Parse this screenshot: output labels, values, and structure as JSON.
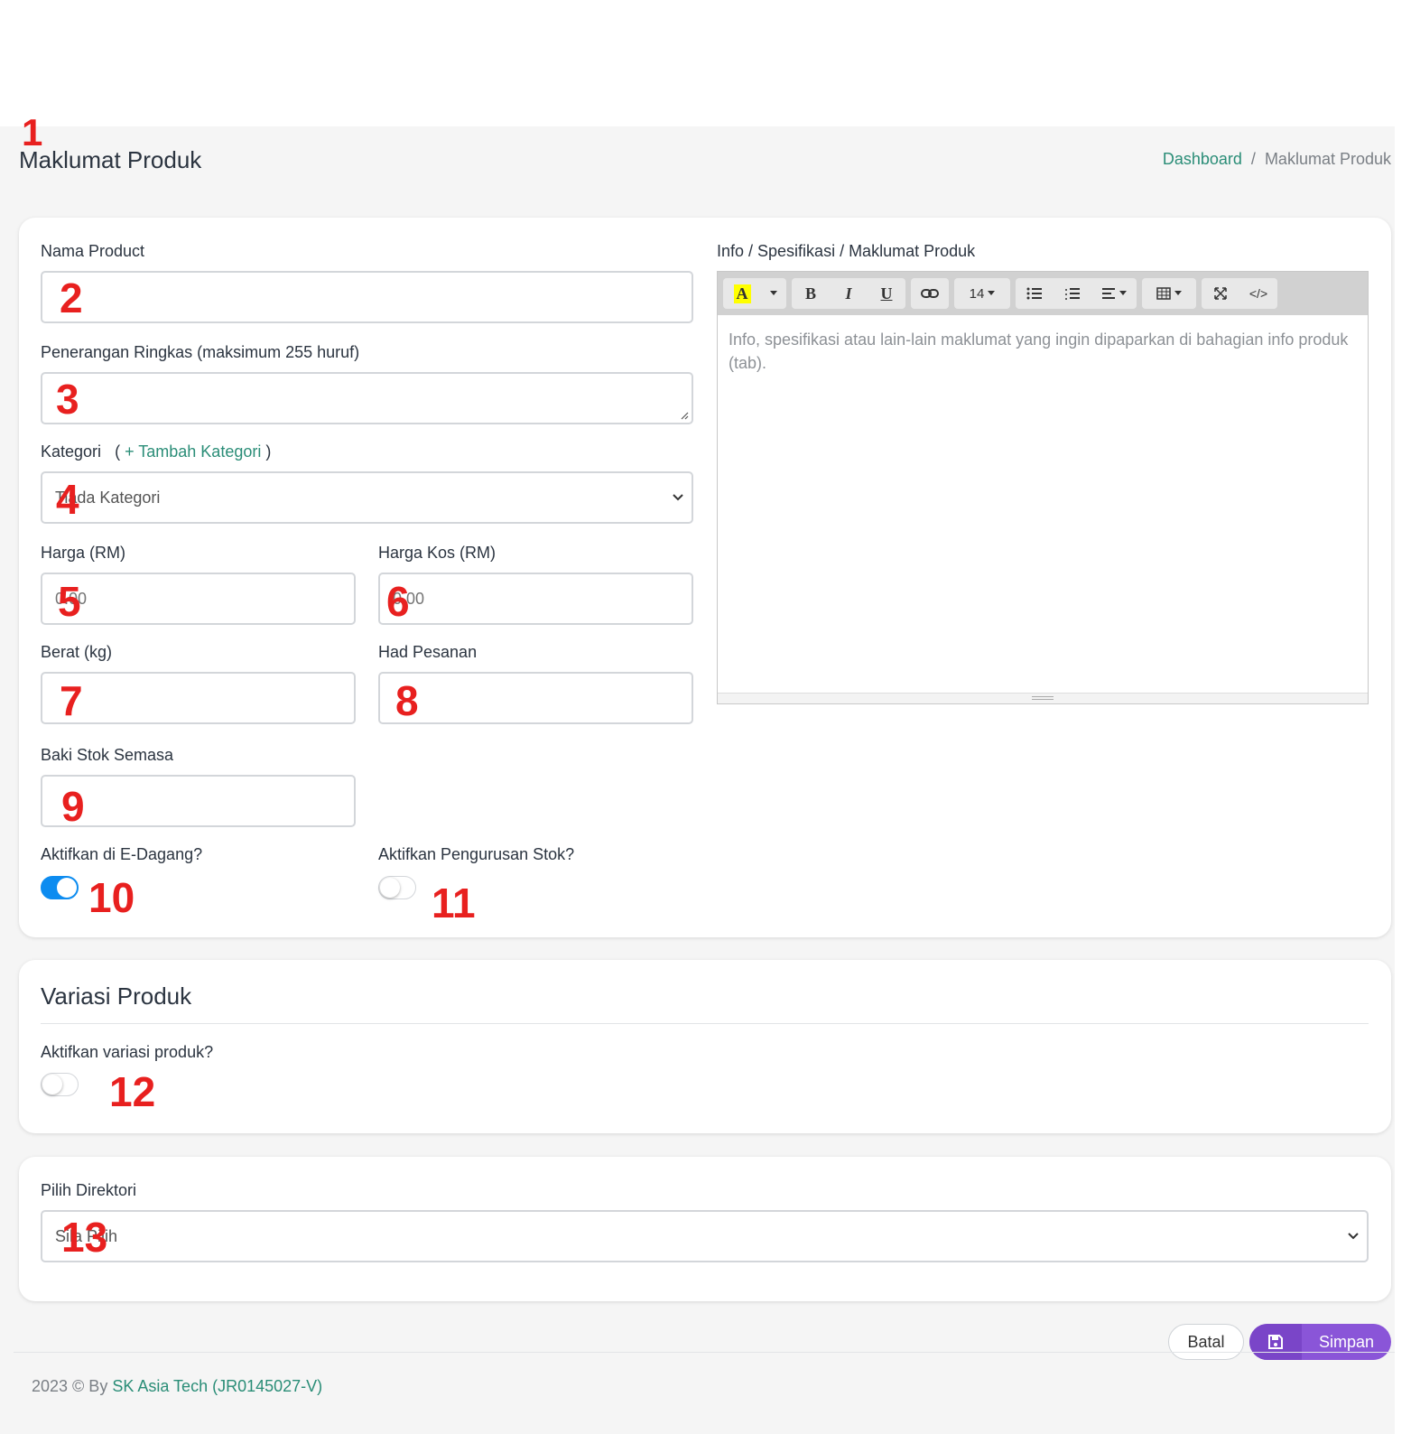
{
  "page": {
    "title": "Maklumat Produk",
    "breadcrumb": {
      "home": "Dashboard",
      "separator": "/",
      "current": "Maklumat Produk"
    }
  },
  "form": {
    "nama_product": {
      "label": "Nama Product",
      "value": ""
    },
    "penerangan": {
      "label": "Penerangan Ringkas (maksimum 255 huruf)",
      "value": ""
    },
    "kategori": {
      "label": "Kategori",
      "add_open": "(",
      "add_link": "+ Tambah Kategori",
      "add_close": ")",
      "selected": "Tiada Kategori"
    },
    "harga": {
      "label": "Harga (RM)",
      "placeholder": "0.00"
    },
    "harga_kos": {
      "label": "Harga Kos (RM)",
      "placeholder": "0.00"
    },
    "berat": {
      "label": "Berat (kg)",
      "value": ""
    },
    "had_pesanan": {
      "label": "Had Pesanan",
      "value": ""
    },
    "baki_stok": {
      "label": "Baki Stok Semasa",
      "value": ""
    },
    "edagang": {
      "label": "Aktifkan di E-Dagang?",
      "enabled": true
    },
    "pengurusan_stok": {
      "label": "Aktifkan Pengurusan Stok?",
      "enabled": false
    }
  },
  "editor": {
    "label": "Info / Spesifikasi / Maklumat Produk",
    "placeholder": "Info, spesifikasi atau lain-lain maklumat yang ingin dipaparkan di bahagian info produk (tab).",
    "toolbar": {
      "highlight": "A",
      "bold": "B",
      "italic": "I",
      "underline": "U",
      "font_size": "14",
      "code": "</>"
    }
  },
  "variasi": {
    "title": "Variasi Produk",
    "label": "Aktifkan variasi produk?",
    "enabled": false
  },
  "direktori": {
    "label": "Pilih Direktori",
    "selected": "Sila Pilih"
  },
  "actions": {
    "cancel": "Batal",
    "save": "Simpan"
  },
  "footer": {
    "text": "2023 © By",
    "company": "SK Asia Tech (JR0145027-V)"
  },
  "annotations": [
    "1",
    "2",
    "3",
    "4",
    "5",
    "6",
    "7",
    "8",
    "9",
    "10",
    "11",
    "12",
    "13"
  ],
  "colors": {
    "accent_link": "#2a8d77",
    "switch_on": "#0d8cf0",
    "save_button": "#8a55d8",
    "annotation": "#e8201f"
  }
}
